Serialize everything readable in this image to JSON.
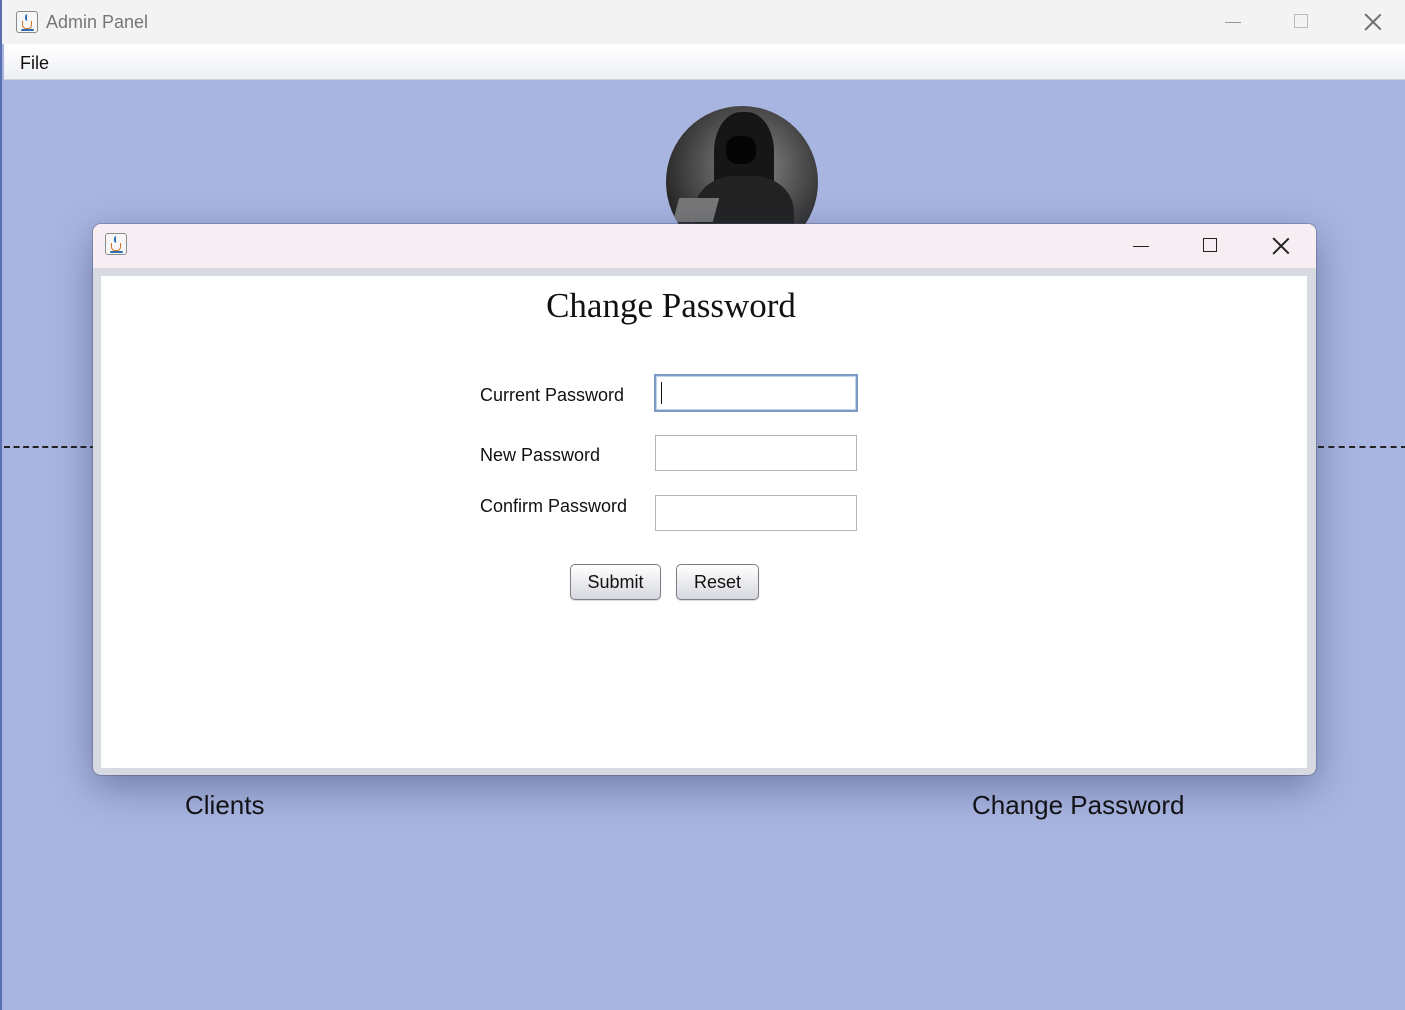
{
  "main_window": {
    "title": "Admin Panel",
    "menu": [
      "File"
    ],
    "captions": {
      "clients": "Clients",
      "change_password": "Change Password"
    }
  },
  "dialog": {
    "heading": "Change Password",
    "fields": [
      {
        "label": "Current Password",
        "value": "",
        "focused": true
      },
      {
        "label": "New Password",
        "value": ""
      },
      {
        "label": "Confirm Password",
        "value": ""
      }
    ],
    "buttons": {
      "submit": "Submit",
      "reset": "Reset"
    }
  },
  "icons": [
    "java-app-icon",
    "minimize-icon",
    "maximize-icon",
    "close-icon",
    "hooded-figure-avatar"
  ],
  "colors": {
    "background": "#a9b5e1",
    "dialog_titlebar": "#f6eef2",
    "focus_border": "#7b9ac4"
  }
}
